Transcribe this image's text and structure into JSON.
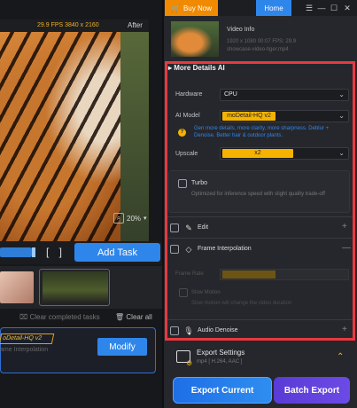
{
  "topbar": {
    "buy_now": "Buy Now",
    "home": "Home",
    "cart_icon": "cart-icon",
    "window_buttons": [
      "☰",
      "—",
      "☐",
      "✕"
    ]
  },
  "preview": {
    "fps_info": "29.9 FPS  3840 x 2160",
    "after_label": "After",
    "zoom": "20%"
  },
  "timeline": {
    "add_task": "Add Task",
    "progress_fraction": 0.2
  },
  "task_list": {
    "clear_completed": "Clear completed tasks",
    "clear_all": "Clear all",
    "task_tag": "oDetail-HQ  v2",
    "task_sub": "ame Interpolation",
    "modify": "Modify"
  },
  "video_info": {
    "title": "Video Info",
    "meta": "1920 x 1080  00:07   FPS: 29.9",
    "file": "showcase-video-tiger.mp4"
  },
  "more_details": {
    "header": "More Details AI",
    "hardware_label": "Hardware",
    "hardware_value": "CPU",
    "ai_model_label": "AI Model",
    "ai_model_value": "moDetail-HQ  v2",
    "hint": "Gen more details, more clarity, more sharpness. Deblur + Denoise. Better hair & outdoor plants.",
    "upscale_label": "Upscale",
    "upscale_value": "x2",
    "turbo_label": "Turbo",
    "turbo_desc": "Optimized for inference speed with slight quality trade-off"
  },
  "sections": {
    "edit": "Edit",
    "frame_interpolation": "Frame Interpolation",
    "frame_rate_label": "Frame Rate",
    "slow_motion_label": "Slow Motion",
    "slow_motion_desc": "Slow motion will change the video duration",
    "audio_denoise": "Audio Denoise"
  },
  "export": {
    "settings_title": "Export Settings",
    "format": "mp4 [ H.264, AAC ]",
    "export_current": "Export Current",
    "batch_export": "Batch Export"
  }
}
